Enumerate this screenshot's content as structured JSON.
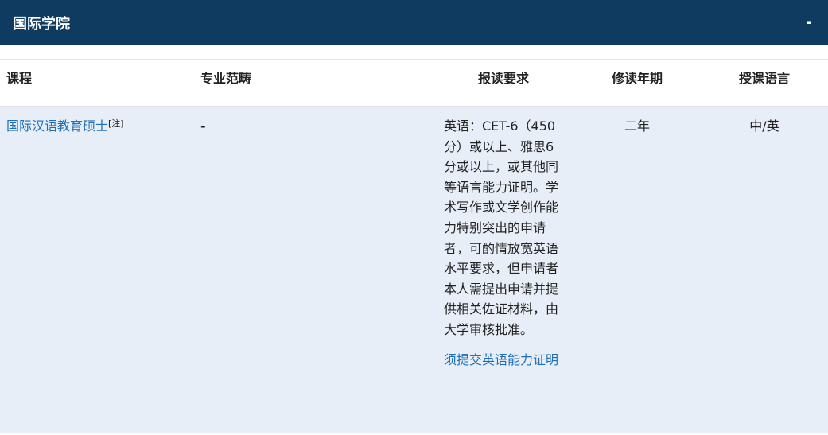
{
  "section": {
    "title": "国际学院",
    "toggle": "-"
  },
  "table": {
    "headers": {
      "course": "课程",
      "field": "专业范畴",
      "requirements": "报读要求",
      "years": "修读年期",
      "language": "授课语言"
    },
    "rows": [
      {
        "course": "国际汉语教育硕士",
        "note": "[注]",
        "field": "-",
        "requirement_text": "英语：CET-6（450分）或以上、雅思6分或以上，或其他同等语言能力证明。学术写作或文学创作能力特别突出的申请者，可酌情放宽英语水平要求，但申请者本人需提出申请并提供相关佐证材料，由大学审核批准。",
        "requirement_link": "须提交英语能力证明",
        "years": "二年",
        "language": "中/英"
      }
    ]
  },
  "colors": {
    "header_bg": "#0f3b60",
    "row_bg": "#e8eef7",
    "link": "#1f6fb5"
  }
}
